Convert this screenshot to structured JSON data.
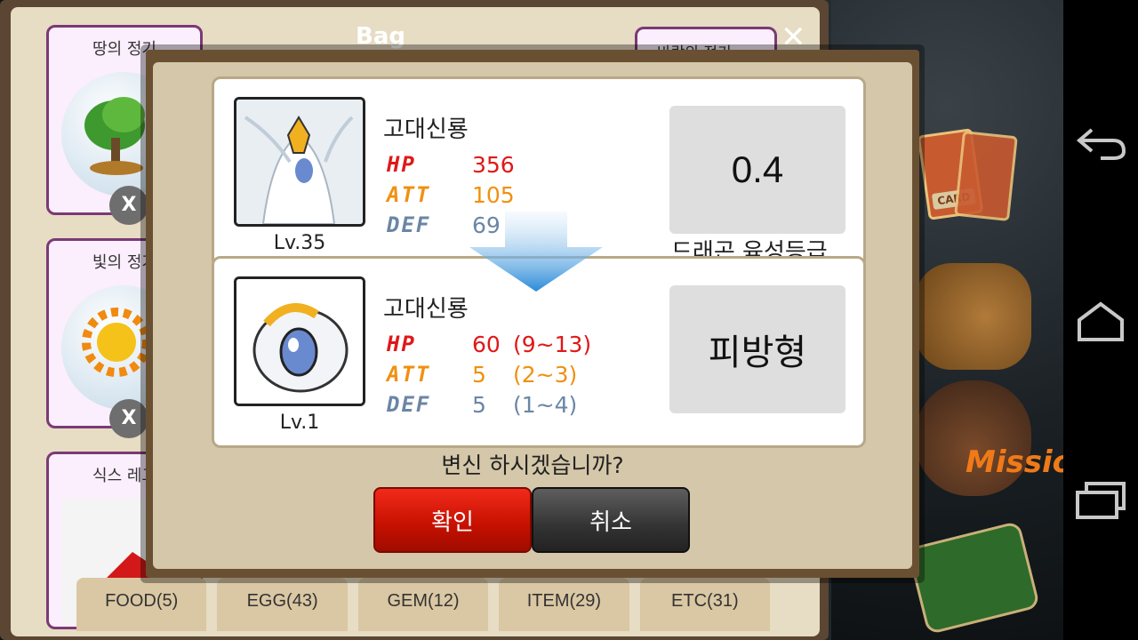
{
  "bag": {
    "title": "Bag",
    "close_icon": "close-icon",
    "left_cards": [
      {
        "title": "땅의 정기",
        "remove_label": "X",
        "icon": "tree-orb-icon"
      },
      {
        "title": "빛의 정기",
        "remove_label": "X",
        "icon": "sun-orb-icon"
      },
      {
        "title": "식스 레그",
        "icon": "red-item-icon"
      }
    ],
    "right_tab_label": "바람의 정기",
    "tabs": [
      "FOOD(5)",
      "EGG(43)",
      "GEM(12)",
      "ITEM(29)",
      "ETC(31)"
    ]
  },
  "side_menu": {
    "card_label": "CARD",
    "mission_label": "Mission",
    "book_icon": "book-of-dragons-icon",
    "backpack_icon": "backpack-icon"
  },
  "dialog": {
    "current": {
      "name": "고대신룡",
      "level": "Lv.35",
      "hp_label": "HP",
      "hp": "356",
      "att_label": "ATT",
      "att": "105",
      "def_label": "DEF",
      "def": "69",
      "grade_value": "0.4",
      "grade_label": "드래곤 육성등급"
    },
    "arrow_icon": "down-arrow-icon",
    "result": {
      "name": "고대신룡",
      "level": "Lv.1",
      "hp_label": "HP",
      "hp": "60",
      "hp_range": "(9~13)",
      "att_label": "ATT",
      "att": "5",
      "att_range": "(2~3)",
      "def_label": "DEF",
      "def": "5",
      "def_range": "(1~4)",
      "type": "피방형"
    },
    "question": "변신 하시겠습니까?",
    "confirm_label": "확인",
    "cancel_label": "취소"
  },
  "nav": {
    "back_icon": "back-icon",
    "home_icon": "home-icon",
    "recents_icon": "recents-icon"
  },
  "colors": {
    "hp": "#e01818",
    "att": "#f09010",
    "def": "#6a86a6",
    "confirm": "#d41a0a",
    "cancel": "#3a3a3a"
  }
}
